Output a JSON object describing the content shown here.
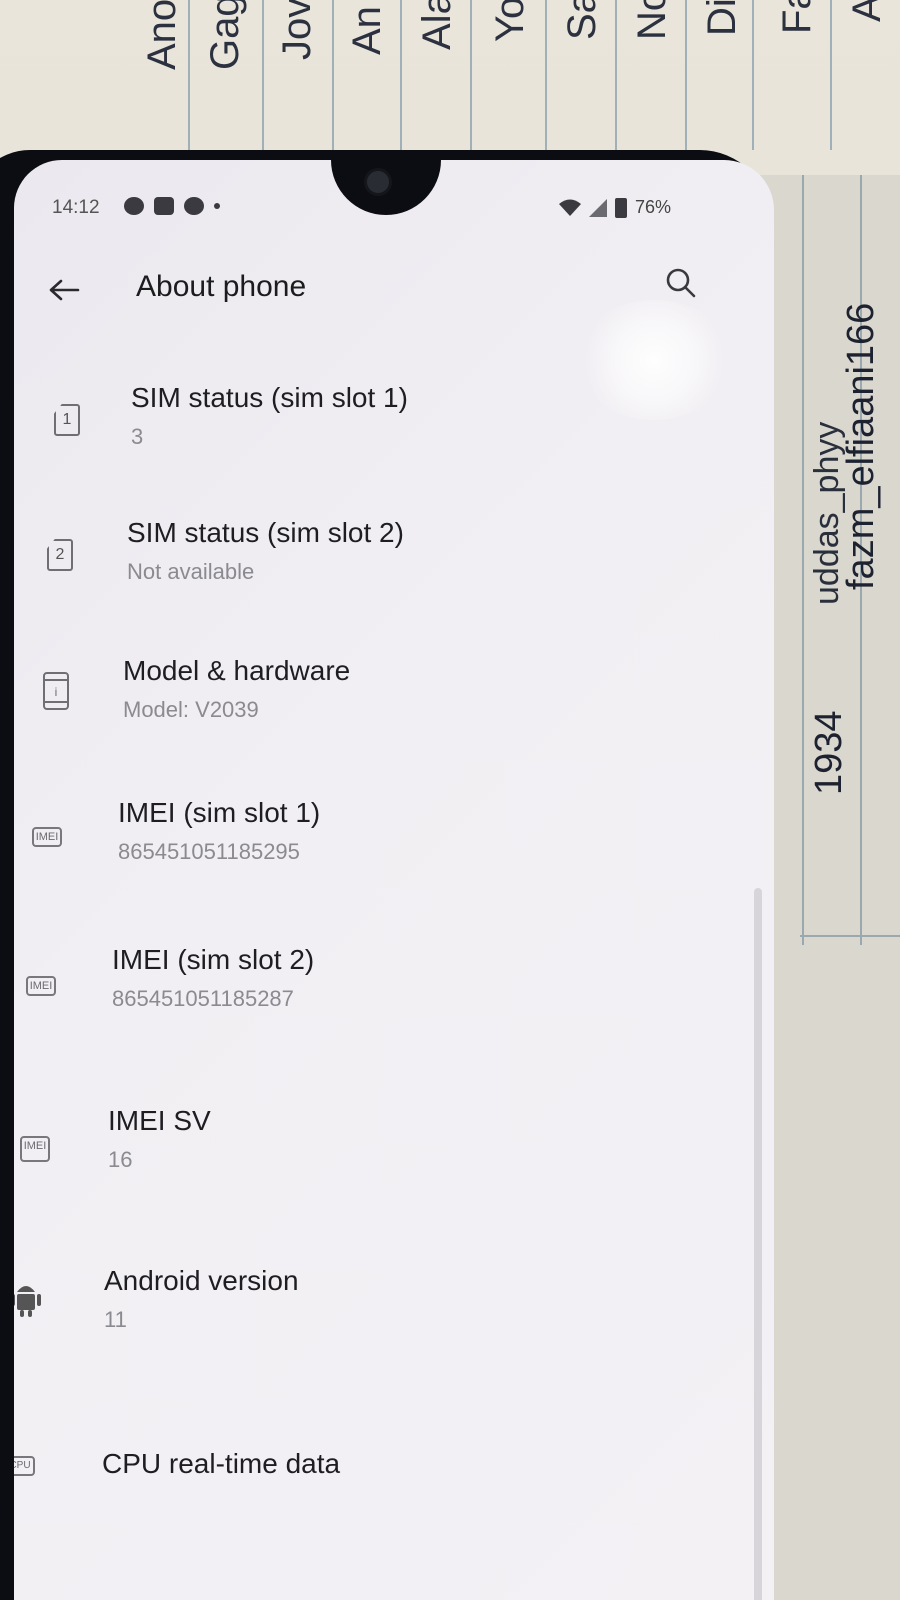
{
  "background": {
    "paper_words": [
      "Ano",
      "Gag",
      "Jov",
      "An",
      "Ala",
      "Yo",
      "Sa",
      "No",
      "Di",
      "Fa",
      "A"
    ],
    "side_words": [
      "1934",
      "uddas_phyy",
      "fazm_elfiaani166"
    ]
  },
  "status_bar": {
    "time": "14:12",
    "battery": "76%"
  },
  "app_bar": {
    "title": "About phone",
    "back_icon": "arrow-left-icon",
    "search_icon": "search-icon"
  },
  "items": [
    {
      "title": "SIM status (sim slot 1)",
      "subtitle": "3",
      "icon": "sim-1-icon",
      "icon_text": "1"
    },
    {
      "title": "SIM status (sim slot 2)",
      "subtitle": "Not available",
      "icon": "sim-2-icon",
      "icon_text": "2"
    },
    {
      "title": "Model & hardware",
      "subtitle": "Model: V2039",
      "icon": "phone-info-icon",
      "icon_text": "i"
    },
    {
      "title": "IMEI (sim slot 1)",
      "subtitle": "865451051185295",
      "icon": "imei-icon",
      "icon_text": "IMEI"
    },
    {
      "title": "IMEI (sim slot 2)",
      "subtitle": "865451051185287",
      "icon": "imei-icon",
      "icon_text": "IMEI"
    },
    {
      "title": "IMEI SV",
      "subtitle": "16",
      "icon": "imei-sv-icon",
      "icon_text": "IMEI"
    },
    {
      "title": "Android version",
      "subtitle": "11",
      "icon": "android-icon"
    },
    {
      "title": "CPU real-time data",
      "subtitle": "",
      "icon": "cpu-icon",
      "icon_text": "CPU"
    }
  ]
}
